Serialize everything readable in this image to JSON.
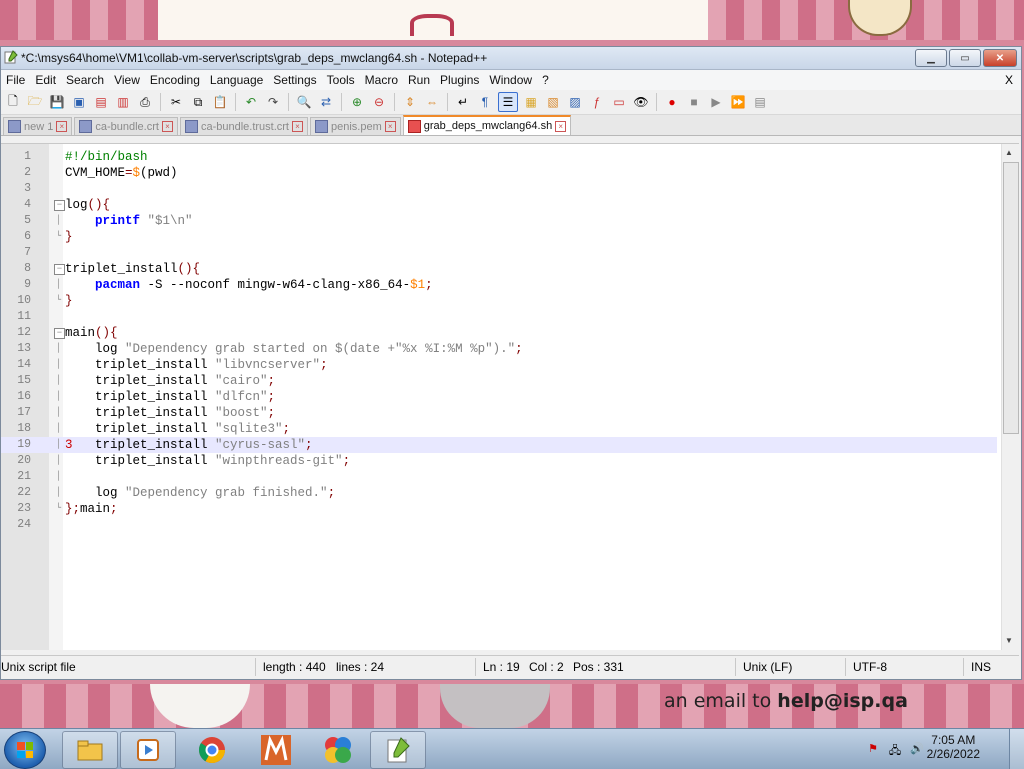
{
  "window": {
    "title": "*C:\\msys64\\home\\VM1\\collab-vm-server\\scripts\\grab_deps_mwclang64.sh - Notepad++",
    "min_label": "▁",
    "max_label": "▭",
    "close_label": "✕"
  },
  "menu": [
    "File",
    "Edit",
    "Search",
    "View",
    "Encoding",
    "Language",
    "Settings",
    "Tools",
    "Macro",
    "Run",
    "Plugins",
    "Window",
    "?"
  ],
  "menu_close": "X",
  "tabs": [
    {
      "label": "new 1",
      "active": false
    },
    {
      "label": "ca-bundle.crt",
      "active": false
    },
    {
      "label": "ca-bundle.trust.crt",
      "active": false
    },
    {
      "label": "penis.pem",
      "active": false
    },
    {
      "label": "grab_deps_mwclang64.sh",
      "active": true
    }
  ],
  "editor": {
    "current_line": 19,
    "change_marker": "3",
    "lines": [
      {
        "n": "1",
        "fold": "",
        "html": "<span class=\"c-cmt\">#!/bin/bash</span>"
      },
      {
        "n": "2",
        "fold": "",
        "html": "CVM_HOME<span class=\"c-op\">=</span><span class=\"c-var\">$</span>(pwd)"
      },
      {
        "n": "3",
        "fold": "",
        "html": ""
      },
      {
        "n": "4",
        "fold": "box",
        "html": "log<span class=\"c-op\">()</span><span class=\"c-op\">{</span>"
      },
      {
        "n": "5",
        "fold": "bar",
        "html": "    <span class=\"c-kw\">printf</span> <span class=\"c-str\">\"$1\\n\"</span>"
      },
      {
        "n": "6",
        "fold": "end",
        "html": "<span class=\"c-op\">}</span>"
      },
      {
        "n": "7",
        "fold": "",
        "html": ""
      },
      {
        "n": "8",
        "fold": "box",
        "html": "triplet_install<span class=\"c-op\">()</span><span class=\"c-op\">{</span>"
      },
      {
        "n": "9",
        "fold": "bar",
        "html": "    <span class=\"c-kw\">pacman</span> -S --noconf mingw-w64-clang-x86_64-<span class=\"c-var\">$1</span><span class=\"c-op\">;</span>"
      },
      {
        "n": "10",
        "fold": "end",
        "html": "<span class=\"c-op\">}</span>"
      },
      {
        "n": "11",
        "fold": "",
        "html": ""
      },
      {
        "n": "12",
        "fold": "box",
        "html": "main<span class=\"c-op\">()</span><span class=\"c-op\">{</span>"
      },
      {
        "n": "13",
        "fold": "bar",
        "html": "    log <span class=\"c-str\">\"Dependency grab started on $(date +\"%x %I:%M %p\").\"</span><span class=\"c-op\">;</span>"
      },
      {
        "n": "14",
        "fold": "bar",
        "html": "    triplet_install <span class=\"c-str\">\"libvncserver\"</span><span class=\"c-op\">;</span>"
      },
      {
        "n": "15",
        "fold": "bar",
        "html": "    triplet_install <span class=\"c-str\">\"cairo\"</span><span class=\"c-op\">;</span>"
      },
      {
        "n": "16",
        "fold": "bar",
        "html": "    triplet_install <span class=\"c-str\">\"dlfcn\"</span><span class=\"c-op\">;</span>"
      },
      {
        "n": "17",
        "fold": "bar",
        "html": "    triplet_install <span class=\"c-str\">\"boost\"</span><span class=\"c-op\">;</span>"
      },
      {
        "n": "18",
        "fold": "bar",
        "html": "    triplet_install <span class=\"c-str\">\"sqlite3\"</span><span class=\"c-op\">;</span>"
      },
      {
        "n": "19",
        "fold": "bar",
        "html": "    triplet_install <span class=\"c-str\">\"cyrus-sasl\"</span><span class=\"c-op\">;</span>"
      },
      {
        "n": "20",
        "fold": "bar",
        "html": "    triplet_install <span class=\"c-str\">\"winpthreads-git\"</span><span class=\"c-op\">;</span>"
      },
      {
        "n": "21",
        "fold": "bar",
        "html": ""
      },
      {
        "n": "22",
        "fold": "bar",
        "html": "    log <span class=\"c-str\">\"Dependency grab finished.\"</span><span class=\"c-op\">;</span>"
      },
      {
        "n": "23",
        "fold": "end",
        "html": "<span class=\"c-op\">}</span><span class=\"c-op\">;</span>main<span class=\"c-op\">;</span>"
      },
      {
        "n": "24",
        "fold": "",
        "html": ""
      }
    ]
  },
  "status": {
    "filetype": "Unix script file",
    "length": "length : 440",
    "lines": "lines : 24",
    "ln": "Ln : 19",
    "col": "Col : 2",
    "pos": "Pos : 331",
    "eol": "Unix (LF)",
    "encoding": "UTF-8",
    "mode": "INS"
  },
  "wallpaper": {
    "email_prefix": "an email to",
    "email": "help@isp.qa"
  },
  "clock": {
    "time": "7:05 AM",
    "date": "2/26/2022"
  }
}
